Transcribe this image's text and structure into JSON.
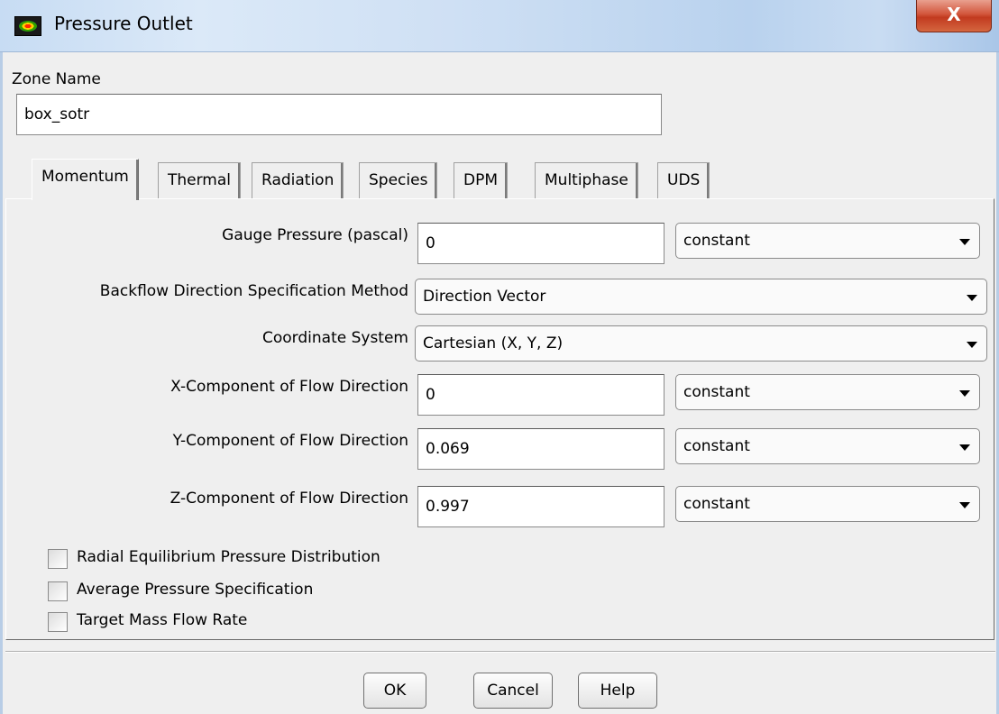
{
  "window": {
    "title": "Pressure Outlet",
    "close_glyph": "X"
  },
  "zone": {
    "label": "Zone Name",
    "value": "box_sotr"
  },
  "tabs": [
    {
      "label": "Momentum"
    },
    {
      "label": "Thermal"
    },
    {
      "label": "Radiation"
    },
    {
      "label": "Species"
    },
    {
      "label": "DPM"
    },
    {
      "label": "Multiphase"
    },
    {
      "label": "UDS"
    }
  ],
  "momentum": {
    "gauge_pressure": {
      "label": "Gauge Pressure (pascal)",
      "value": "0",
      "method": "constant"
    },
    "backflow_method": {
      "label": "Backflow Direction Specification Method",
      "value": "Direction Vector"
    },
    "coordinate_system": {
      "label": "Coordinate System",
      "value": "Cartesian (X, Y, Z)"
    },
    "x_component": {
      "label": "X-Component of Flow Direction",
      "value": "0",
      "method": "constant"
    },
    "y_component": {
      "label": "Y-Component of Flow Direction",
      "value": "0.069",
      "method": "constant"
    },
    "z_component": {
      "label": "Z-Component of Flow Direction",
      "value": "0.997",
      "method": "constant"
    },
    "checkboxes": [
      {
        "label": "Radial Equilibrium Pressure Distribution",
        "checked": false
      },
      {
        "label": "Average Pressure Specification",
        "checked": false
      },
      {
        "label": "Target Mass Flow Rate",
        "checked": false
      }
    ]
  },
  "buttons": {
    "ok": "OK",
    "cancel": "Cancel",
    "help": "Help"
  }
}
